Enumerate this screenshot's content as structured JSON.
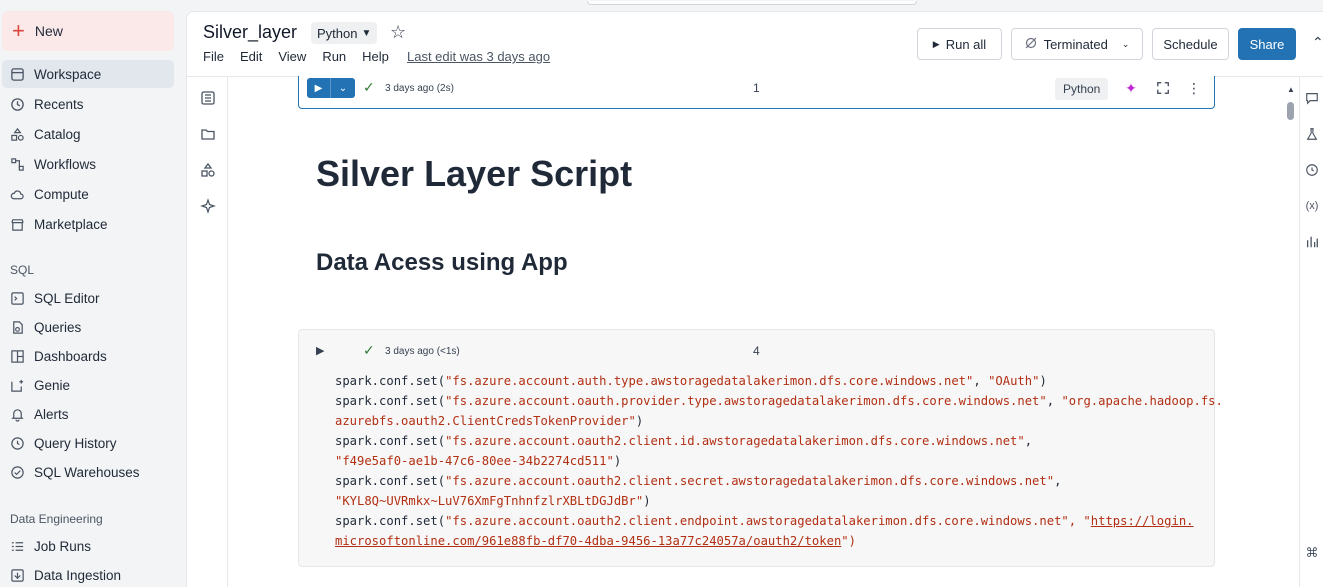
{
  "sidebar": {
    "new_label": "New",
    "items": [
      {
        "label": "Workspace"
      },
      {
        "label": "Recents"
      },
      {
        "label": "Catalog"
      },
      {
        "label": "Workflows"
      },
      {
        "label": "Compute"
      },
      {
        "label": "Marketplace"
      }
    ],
    "sql_section": "SQL",
    "sql_items": [
      {
        "label": "SQL Editor"
      },
      {
        "label": "Queries"
      },
      {
        "label": "Dashboards"
      },
      {
        "label": "Genie"
      },
      {
        "label": "Alerts"
      },
      {
        "label": "Query History"
      },
      {
        "label": "SQL Warehouses"
      }
    ],
    "de_section": "Data Engineering",
    "de_items": [
      {
        "label": "Job Runs"
      },
      {
        "label": "Data Ingestion"
      }
    ]
  },
  "notebook": {
    "title": "Silver_layer",
    "language": "Python",
    "menu": [
      "File",
      "Edit",
      "View",
      "Run",
      "Help"
    ],
    "last_edit": "Last edit was 3 days ago"
  },
  "toolbar": {
    "run_all": "Run all",
    "cluster_status": "Terminated",
    "schedule": "Schedule",
    "share": "Share"
  },
  "cells": {
    "cell1": {
      "time": "3 days ago (2s)",
      "number": "1",
      "language": "Python"
    },
    "markdown_h1": "Silver Layer Script",
    "markdown_h2": "Data Acess using App",
    "cell4": {
      "time": "3 days ago (<1s)",
      "number": "4",
      "code": {
        "l1_a": "spark.conf.set(",
        "l1_s1": "\"fs.azure.account.auth.type.awstoragedatalakerimon.dfs.core.windows.net\"",
        "l1_b": ", ",
        "l1_s2": "\"OAuth\"",
        "l1_c": ")",
        "l2_a": "spark.conf.set(",
        "l2_s1": "\"fs.azure.account.oauth.provider.type.awstoragedatalakerimon.dfs.core.windows.net\"",
        "l2_b": ", ",
        "l2_s2": "\"org.apache.hadoop.fs.",
        "l3_s": "azurebfs.oauth2.ClientCredsTokenProvider\"",
        "l3_c": ")",
        "l4_a": "spark.conf.set(",
        "l4_s1": "\"fs.azure.account.oauth2.client.id.awstoragedatalakerimon.dfs.core.windows.net\"",
        "l4_b": ",",
        "l5_s": "\"f49e5af0-ae1b-47c6-80ee-34b2274cd511\"",
        "l5_c": ")",
        "l6_a": "spark.conf.set(",
        "l6_s1": "\"fs.azure.account.oauth2.client.secret.awstoragedatalakerimon.dfs.core.windows.net\"",
        "l6_b": ",",
        "l7_s": "\"KYL8Q~UVRmkx~LuV76XmFgTnhnfzlrXBLtDGJdBr\"",
        "l7_c": ")",
        "l8_a": "spark.conf.set(",
        "l8_s1": "\"fs.azure.account.oauth2.client.endpoint.awstoragedatalakerimon.dfs.core.windows.net\"",
        "l8_b": ", \"",
        "l8_u": "https://login.",
        "l9_u": "microsoftonline.com/961e88fb-df70-4dba-9456-13a77c24057a/oauth2/token",
        "l9_c": "\")"
      }
    }
  },
  "colors": {
    "accent": "#2272b4",
    "string": "#b22f12",
    "new_button_bg": "#fbe9ea",
    "success": "#2e7d32"
  }
}
